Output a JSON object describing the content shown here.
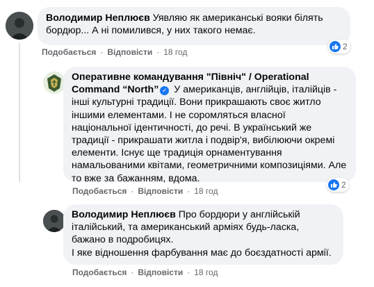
{
  "comments": [
    {
      "author": "Володимир Неплюєв",
      "text": " Уявляю як американські вояки білять бордюр... А ні помилився, у них такого немає.",
      "like_label": "Подобається",
      "reply_label": "Відповісти",
      "time": "18 год",
      "reactions": "2",
      "avatar_icon": "user-photo"
    },
    {
      "author": "Оперативне командування \"Північ\" / Operational Command “North”",
      "text": " У американців, англійців, італійців - інші культурні традиції. Вони прикрашають своє житло іншими елементами. І не соромляться власної національної ідентичності, до речі. В український же традиції - прикрашати житла і подвір'я, вибілюючи окремі елементи. Існує ще традиція орнаментування намальованими квітами, геометричними композиціями. Але то вже за бажанням, вдома.",
      "like_label": "Подобається",
      "reply_label": "Відповісти",
      "time": "18 год",
      "reactions": "2",
      "avatar_icon": "military-emblem",
      "verified_icon": "check-icon"
    },
    {
      "author": "Володимир Неплюєв",
      "text_lines": [
        " Про бордюри у англійській італійський, та американський арміях будь-ласка, бажано в подробицях.",
        "І яке відношення фарбування має до боєздатності армії."
      ],
      "like_label": "Подобається",
      "reply_label": "Відповісти",
      "time": "18 год",
      "avatar_icon": "user-photo"
    }
  ],
  "separator": "·",
  "colors": {
    "bubble": "#f0f2f5",
    "meta": "#65676b",
    "like": "#1877f2"
  }
}
